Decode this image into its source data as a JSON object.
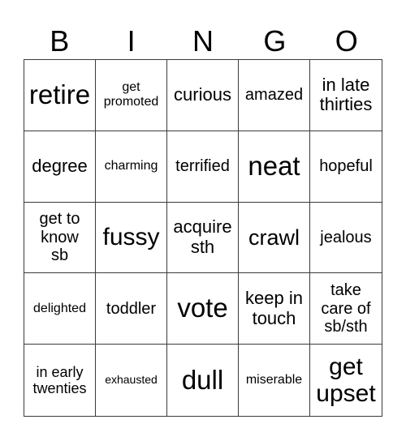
{
  "title_letters": [
    "B",
    "I",
    "N",
    "G",
    "O"
  ],
  "cells": [
    [
      "retire",
      "get promoted",
      "curious",
      "amazed",
      "in late thirties"
    ],
    [
      "degree",
      "charming",
      "terrified",
      "neat",
      "hopeful"
    ],
    [
      "get to know sb",
      "fussy",
      "acquire sth",
      "crawl",
      "jealous"
    ],
    [
      "delighted",
      "toddler",
      "vote",
      "keep in touch",
      "take care of sb/sth"
    ],
    [
      "in early twenties",
      "exhausted",
      "dull",
      "miserable",
      "get upset"
    ]
  ]
}
